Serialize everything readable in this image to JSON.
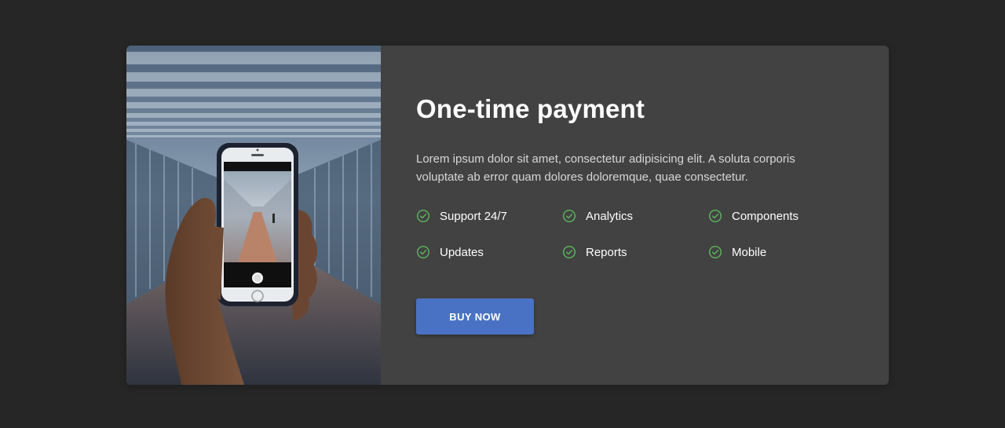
{
  "card": {
    "title": "One-time payment",
    "description": "Lorem ipsum dolor sit amet, consectetur adipisicing elit. A soluta corporis voluptate ab error quam dolores doloremque, quae consectetur.",
    "features": [
      {
        "label": "Support 24/7",
        "icon": "check-circle-icon"
      },
      {
        "label": "Analytics",
        "icon": "check-circle-icon"
      },
      {
        "label": "Components",
        "icon": "check-circle-icon"
      },
      {
        "label": "Updates",
        "icon": "check-circle-icon"
      },
      {
        "label": "Reports",
        "icon": "check-circle-icon"
      },
      {
        "label": "Mobile",
        "icon": "check-circle-icon"
      }
    ],
    "button_label": "BUY NOW"
  },
  "colors": {
    "page_background": "#262626",
    "card_background": "#424242",
    "accent_button": "#4a72c4",
    "check_green": "#5cb85c"
  }
}
